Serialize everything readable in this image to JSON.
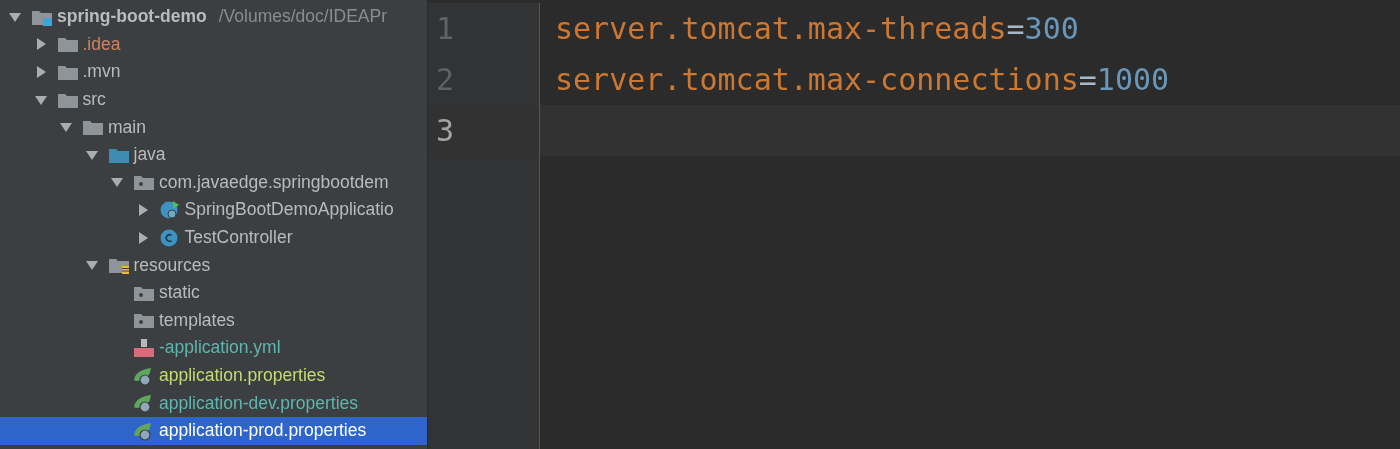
{
  "project_tree": {
    "items": [
      {
        "label": "spring-boot-demo",
        "path": "/Volumes/doc/IDEAPr",
        "kind": "module",
        "expanded": true,
        "selected": false,
        "children": [
          {
            "label": ".idea",
            "kind": "folder",
            "expanded": false,
            "selected": false,
            "color": "#d1825f"
          },
          {
            "label": ".mvn",
            "kind": "folder",
            "expanded": false,
            "selected": false
          },
          {
            "label": "src",
            "kind": "folder",
            "expanded": true,
            "selected": false,
            "children": [
              {
                "label": "main",
                "kind": "folder",
                "expanded": true,
                "selected": false,
                "children": [
                  {
                    "label": "java",
                    "kind": "source-folder",
                    "expanded": true,
                    "selected": false,
                    "children": [
                      {
                        "label": "com.javaedge.springbootdem",
                        "kind": "package",
                        "expanded": true,
                        "selected": false,
                        "children": [
                          {
                            "label": "SpringBootDemoApplicatio",
                            "kind": "spring-class",
                            "expanded": false,
                            "selected": false
                          },
                          {
                            "label": "TestController",
                            "kind": "class",
                            "expanded": false,
                            "selected": false
                          }
                        ]
                      }
                    ]
                  },
                  {
                    "label": "resources",
                    "kind": "resources-folder",
                    "expanded": true,
                    "selected": false,
                    "children": [
                      {
                        "label": "static",
                        "kind": "package",
                        "selected": false
                      },
                      {
                        "label": "templates",
                        "kind": "package",
                        "selected": false
                      },
                      {
                        "label": "-application.yml",
                        "kind": "yml",
                        "selected": false,
                        "color": "#5fb6ae"
                      },
                      {
                        "label": "application.properties",
                        "kind": "spring-properties",
                        "selected": false,
                        "color": "#c9d96f"
                      },
                      {
                        "label": "application-dev.properties",
                        "kind": "spring-properties",
                        "selected": false,
                        "color": "#5fb6ae"
                      },
                      {
                        "label": "application-prod.properties",
                        "kind": "spring-properties",
                        "selected": true
                      }
                    ]
                  }
                ]
              }
            ]
          }
        ]
      }
    ]
  },
  "editor": {
    "lines": [
      {
        "number": "1",
        "key": "server.tomcat.max-threads",
        "separator": "=",
        "value": "300",
        "current": false
      },
      {
        "number": "2",
        "key": "server.tomcat.max-connections",
        "separator": "=",
        "value": "1000",
        "current": false
      },
      {
        "number": "3",
        "current": true
      }
    ]
  }
}
